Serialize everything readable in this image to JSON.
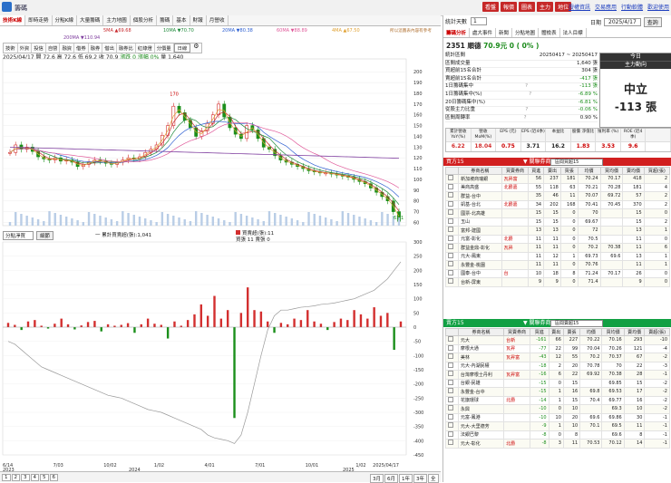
{
  "window": {
    "title": "籌碼"
  },
  "topbar": {
    "buttons": [
      "看盤",
      "報價",
      "圖表",
      "主力",
      "地位"
    ],
    "links": [
      "授權資訊",
      "交易應用",
      "行動軟體",
      "歡迎使用"
    ]
  },
  "left": {
    "tabs": [
      "技術K線",
      "即時走勢",
      "分點K線",
      "大量籌碼",
      "主力地圖",
      "個股分析",
      "籌碼",
      "基本",
      "財報",
      "月營收"
    ],
    "active_tab": 0,
    "ma_legend": [
      "5MA ▲69.68",
      "10MA ▼70.70",
      "20MA ▼80.38",
      "60MA ▼88.89",
      "4MA ▲67.50",
      "200MA ▼110.94"
    ],
    "period_tabs": [
      "技術",
      "外資",
      "投信",
      "自營",
      "融資",
      "借券",
      "融券",
      "借出",
      "融券比",
      "紅綠燈",
      "分價量"
    ],
    "period_select": "日線",
    "info": {
      "text": "2025/04/17 開 72.6 高 72.6 低 69.2 收 70.9",
      "change": "漲跌 0",
      "pct": "漲幅 0%",
      "vol": "量 1,640"
    },
    "notice": "所以這圖表內容有參考",
    "lower_select": "分點淨買",
    "lower_btn": "細節",
    "lower_legend": "一 累計買賣超(張):1,041",
    "lower_legend2": [
      "買賣超(張):11",
      "買張 11 賣張 0"
    ],
    "pager": [
      "1",
      "2",
      "3",
      "4",
      "5",
      "6"
    ],
    "ranges": [
      "3月",
      "6月",
      "1年",
      "3年",
      "全"
    ],
    "xlabels": [
      "6/14",
      "7/03",
      "10/02",
      "1/02",
      "4/01",
      "7/01",
      "10/01",
      "1/02",
      "2025/04/17"
    ],
    "xyear": [
      "2023",
      "2024",
      "2025"
    ]
  },
  "chart_data": [
    {
      "type": "line",
      "title": "",
      "ylim": [
        90,
        210
      ],
      "yticks": [
        90,
        100,
        110,
        120,
        130,
        140,
        150,
        160,
        170,
        180,
        190,
        200
      ],
      "yticks_extra": [
        80,
        70,
        60
      ],
      "annotation": "170",
      "last_label": "61.1",
      "series": [
        {
          "values": [
            125,
            132,
            128,
            130,
            126,
            121,
            119,
            118,
            120,
            117,
            118,
            116,
            112,
            114,
            116,
            118,
            117,
            115,
            114,
            116,
            118,
            120,
            119,
            121,
            125,
            128,
            132,
            141,
            150,
            168,
            162,
            155,
            148,
            140,
            145,
            152,
            160,
            170,
            158,
            148,
            142,
            138,
            150,
            146,
            138,
            130,
            128,
            122,
            118,
            116,
            114,
            112,
            110,
            108,
            107,
            106,
            106,
            105,
            104,
            103,
            102,
            100,
            98,
            96,
            92,
            88,
            84,
            80,
            70,
            61
          ]
        }
      ]
    },
    {
      "type": "bar",
      "title": "",
      "ylim": [
        -450,
        300
      ],
      "yticks": [
        300,
        250,
        200,
        150,
        100,
        50,
        0,
        -50,
        -100,
        -150,
        -200,
        -250,
        -300,
        -350,
        -400,
        -450
      ],
      "series": [
        {
          "name": "買賣超(張)",
          "values": [
            15,
            8,
            -10,
            20,
            25,
            5,
            -5,
            12,
            30,
            10,
            -8,
            6,
            18,
            22,
            -15,
            10,
            5,
            8,
            14,
            -20,
            10,
            30,
            12,
            8,
            -40,
            20,
            5,
            25,
            45,
            80,
            40,
            110,
            30,
            60,
            -320,
            50,
            140,
            60,
            55,
            20,
            -20,
            15,
            10,
            30,
            25,
            60,
            20,
            12,
            -10,
            18,
            30,
            25,
            60,
            45,
            30,
            70,
            40,
            50,
            -80,
            20
          ]
        },
        {
          "name": "累計買賣超(張)",
          "values": [
            -50,
            -60,
            -80,
            -100,
            -120,
            -140,
            -150,
            -160,
            -170,
            -180,
            -190,
            -200,
            -210,
            -220,
            -230,
            -240,
            -245,
            -250,
            -260,
            -270,
            -280,
            -290,
            -295,
            -300,
            -310,
            -320,
            -330,
            -340,
            -350,
            -360,
            -380,
            -390,
            -395,
            -400,
            -410,
            -380,
            -300,
            -200,
            -100,
            -10,
            40,
            60,
            60,
            65,
            70,
            72,
            75,
            80,
            82,
            85,
            90,
            95,
            100,
            110,
            120,
            130,
            150,
            170,
            200,
            230
          ]
        }
      ]
    }
  ],
  "right": {
    "days_label": "統計天數",
    "days_value": "1",
    "date_label": "日期",
    "date_value": "2025/4/17",
    "query": "查詢",
    "tabs": [
      "籌碼分析",
      "處大事件",
      "新聞",
      "分點地圖",
      "體檢表",
      "法人目標"
    ],
    "stock_code": "2351 順德",
    "stock_price": "70.9元",
    "stock_chg": "0 ( 0% )",
    "summary": [
      {
        "k": "統計區間",
        "v": "20250417 ~ 20250417",
        "q": ""
      },
      {
        "k": "區間成交量",
        "v": "1,640 張",
        "q": ""
      },
      {
        "k": "買超前15名合計",
        "v": "304 張",
        "q": ""
      },
      {
        "k": "賣超前15名合計",
        "v": "-417 張",
        "q": ""
      },
      {
        "k": "1日籌碼集中",
        "v": "-113 張",
        "q": "?"
      },
      {
        "k": "1日籌碼集中(%)",
        "v": "-6.89 %",
        "q": "?"
      },
      {
        "k": "20日籌碼集中(%)",
        "v": "-6.81 %",
        "q": ""
      },
      {
        "k": "從股主力比重",
        "v": "-0.06 %",
        "q": "?"
      },
      {
        "k": "區間周轉率",
        "v": "0.90 %",
        "q": "?"
      }
    ],
    "today": {
      "h1": "今日",
      "h2": "主力動向",
      "verdict": "中立",
      "amount": "-113 張"
    },
    "metrics_h": [
      "累計營收 YoY(%)",
      "營收 MoM(%)",
      "EPS (元)",
      "EPS (近4季)",
      "本益比",
      "股價 淨值比",
      "殖利率 (%)",
      "ROE (近4季)",
      ""
    ],
    "metrics_v": [
      "6.22",
      "18.04",
      "0.75",
      "3.71",
      "16.2",
      "1.83",
      "3.53",
      "9.6",
      ""
    ],
    "buy": {
      "title": "買方15",
      "dd": "▼ 關聯券商",
      "select": "區間買超15",
      "cols": [
        "券商名稱",
        "買賣券商",
        "買進",
        "賣出",
        "買張",
        "均價",
        "買均價",
        "賣均價",
        "買超(張)"
      ],
      "rows": [
        [
          "新加坡商瑞銀",
          "瓦昇富",
          "56",
          "237",
          "181",
          "70.24",
          "70.17",
          "418",
          "2"
        ],
        [
          "美商高盛",
          "北爵嘉",
          "55",
          "118",
          "63",
          "70.21",
          "70.28",
          "181",
          "4"
        ],
        [
          "群益-台中",
          "",
          "35",
          "46",
          "11",
          "70.07",
          "69.72",
          "57",
          "2"
        ],
        [
          "凱基-台北",
          "北爵嘉",
          "34",
          "202",
          "168",
          "70.41",
          "70.45",
          "370",
          "2"
        ],
        [
          "國票-北高雄",
          "",
          "15",
          "15",
          "0",
          "70",
          "",
          "15",
          "0"
        ],
        [
          "玉山",
          "",
          "15",
          "15",
          "0",
          "69.67",
          "",
          "15",
          "2"
        ],
        [
          "富邦-建國",
          "",
          "13",
          "13",
          "0",
          "72",
          "",
          "13",
          "1"
        ],
        [
          "元富-彰化",
          "北爵",
          "11",
          "11",
          "0",
          "70.5",
          "",
          "11",
          "0"
        ],
        [
          "群益金鼎-彰化",
          "瓦昇",
          "11",
          "11",
          "0",
          "70.2",
          "70.38",
          "11",
          "6"
        ],
        [
          "元大-鳳東",
          "",
          "11",
          "12",
          "1",
          "69.73",
          "69.6",
          "13",
          "1"
        ],
        [
          "永豐金-桃園",
          "",
          "11",
          "11",
          "0",
          "70.76",
          "",
          "11",
          "1"
        ],
        [
          "國泰-台中",
          "台",
          "10",
          "18",
          "8",
          "71.24",
          "70.17",
          "26",
          "0"
        ],
        [
          "台新-屏東",
          "",
          "9",
          "9",
          "0",
          "71.4",
          "",
          "9",
          "0"
        ]
      ]
    },
    "sell": {
      "title": "賣方15",
      "dd": "▼ 關聯券商",
      "select": "區間賣超15",
      "cols": [
        "券商名稱",
        "買賣券商",
        "買進",
        "賣出",
        "賣張",
        "均價",
        "買均價",
        "賣均價",
        "賣超(張)"
      ],
      "rows": [
        [
          "元大",
          "台新",
          "-161",
          "66",
          "227",
          "70.22",
          "70.16",
          "293",
          "-10"
        ],
        [
          "摩根大通",
          "瓦昇",
          "-77",
          "22",
          "99",
          "70.04",
          "70.26",
          "121",
          "-4"
        ],
        [
          "美林",
          "瓦昇富",
          "-43",
          "12",
          "55",
          "70.2",
          "70.37",
          "67",
          "-2"
        ],
        [
          "元大-內湖民權",
          "",
          "-18",
          "2",
          "20",
          "70.78",
          "70",
          "22",
          "-3"
        ],
        [
          "台灣摩根士丹利",
          "瓦昇富",
          "-16",
          "6",
          "22",
          "69.92",
          "70.38",
          "28",
          "-1"
        ],
        [
          "台銀-民雄",
          "",
          "-15",
          "0",
          "15",
          "",
          "69.85",
          "15",
          "-2"
        ],
        [
          "永豐金-台中",
          "",
          "-15",
          "1",
          "16",
          "69.8",
          "69.53",
          "17",
          "-2"
        ],
        [
          "花旗環球",
          "北爵",
          "-14",
          "1",
          "15",
          "70.4",
          "69.77",
          "16",
          "-2"
        ],
        [
          "永興",
          "",
          "-10",
          "0",
          "10",
          "",
          "69.3",
          "10",
          "-2"
        ],
        [
          "元富-鳳港",
          "",
          "-10",
          "10",
          "20",
          "69.6",
          "69.86",
          "30",
          "-1"
        ],
        [
          "元大-大里德芳",
          "",
          "-9",
          "1",
          "10",
          "70.1",
          "69.5",
          "11",
          "-1"
        ],
        [
          "法銀巴黎",
          "",
          "-8",
          "0",
          "8",
          "",
          "69.6",
          "8",
          "-1"
        ],
        [
          "元大-彰化",
          "北爵",
          "-8",
          "3",
          "11",
          "70.53",
          "70.12",
          "14",
          "-1"
        ]
      ]
    }
  },
  "colors": {
    "up": "#d32f2f",
    "down": "#1b8f1b",
    "header_red": "#d11f1f",
    "header_green": "#11a043",
    "ma5": "#c8282c",
    "ma10": "#1f8a3b",
    "ma20": "#2d5fd1",
    "ma60": "#e05a9a",
    "ma4": "#e0a030",
    "ma200": "#8040a0"
  }
}
